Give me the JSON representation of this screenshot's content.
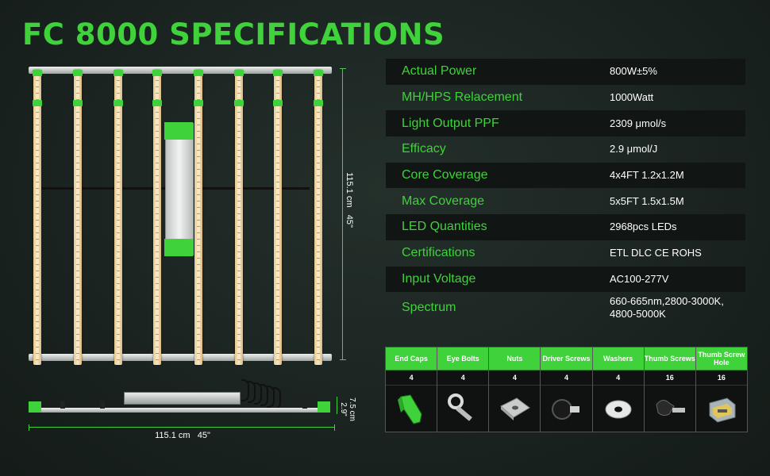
{
  "title": "FC 8000 SPECIFICATIONS",
  "dimensions": {
    "vertical": "115.1 cm   45\"",
    "horizontal": "115.1 cm   45\"",
    "height": "7.5 cm\n2.9\""
  },
  "specs": [
    {
      "label": "Actual Power",
      "value": "800W±5%"
    },
    {
      "label": "MH/HPS Relacement",
      "value": "1000Watt"
    },
    {
      "label": "Light Output PPF",
      "value": "2309 μmol/s"
    },
    {
      "label": "Efficacy",
      "value": "2.9  μmol/J"
    },
    {
      "label": "Core Coverage",
      "value": "4x4FT 1.2x1.2M"
    },
    {
      "label": "Max Coverage",
      "value": "5x5FT 1.5x1.5M"
    },
    {
      "label": "LED Quantities",
      "value": "2968pcs LEDs"
    },
    {
      "label": "Certifications",
      "value": "ETL DLC CE ROHS"
    },
    {
      "label": "Input Voltage",
      "value": "AC100-277V"
    },
    {
      "label": "Spectrum",
      "value": "660-665nm,2800-3000K, 4800-5000K"
    }
  ],
  "parts": [
    {
      "name": "End Caps",
      "qty": "4",
      "icon": "end-cap-icon"
    },
    {
      "name": "Eye Bolts",
      "qty": "4",
      "icon": "eye-bolt-icon"
    },
    {
      "name": "Nuts",
      "qty": "4",
      "icon": "nut-icon"
    },
    {
      "name": "Driver Screws",
      "qty": "4",
      "icon": "driver-screw-icon"
    },
    {
      "name": "Washers",
      "qty": "4",
      "icon": "washer-icon"
    },
    {
      "name": "Thumb Screws",
      "qty": "16",
      "icon": "thumb-screw-icon"
    },
    {
      "name": "Thumb Screw Hole",
      "qty": "16",
      "icon": "thumb-screw-hole-icon"
    }
  ],
  "colors": {
    "accent": "#3fd23a",
    "background": "#1c2622",
    "row_dark": "#111513"
  }
}
